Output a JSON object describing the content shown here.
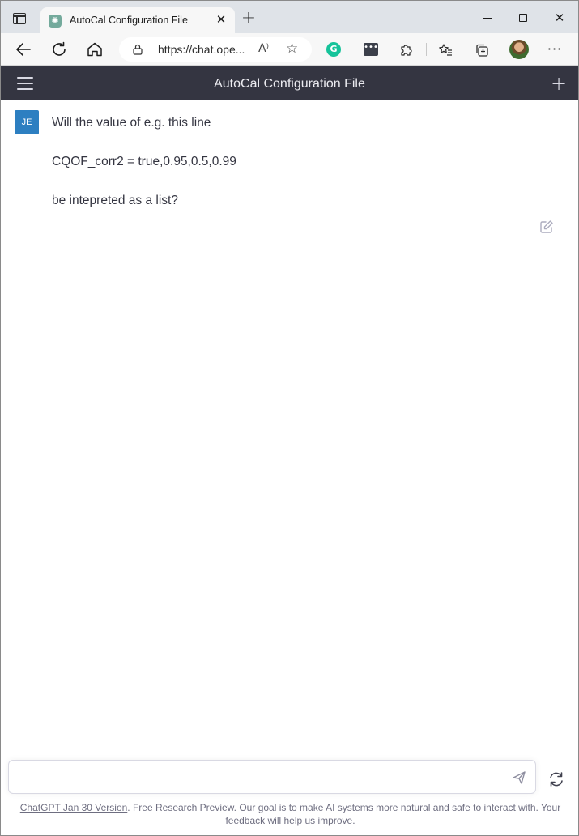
{
  "browser": {
    "tab_title": "AutoCal Configuration File",
    "tab_close": "✕",
    "new_tab": "+",
    "url": "https://chat.ope...",
    "read_aloud": "A⁾",
    "window_close": "✕"
  },
  "app": {
    "title": "AutoCal Configuration File"
  },
  "conversation": {
    "messages": [
      {
        "author_initials": "JE",
        "paragraphs": [
          "Will the value of e.g. this line",
          "CQOF_corr2 = true,0.95,0.5,0.99",
          "be intepreted as a list?"
        ]
      }
    ]
  },
  "composer": {
    "value": "",
    "placeholder": ""
  },
  "footer": {
    "link_text": "ChatGPT Jan 30 Version",
    "text": ". Free Research Preview. Our goal is to make AI systems more natural and safe to interact with. Your feedback will help us improve."
  },
  "colors": {
    "header_bg": "#343541",
    "avatar_bg": "#2d7fc1",
    "tabstrip_bg": "#dfe3e8",
    "grammarly": "#15c39a"
  },
  "icons": [
    "tab-actions-icon",
    "openai-favicon",
    "back-icon",
    "reload-icon",
    "home-icon",
    "lock-icon",
    "read-aloud-icon",
    "add-favorite-icon",
    "grammarly-icon",
    "extension-icon",
    "puzzle-icon",
    "favorites-icon",
    "collections-icon",
    "profile-avatar",
    "more-icon",
    "hamburger-icon",
    "new-chat-icon",
    "edit-icon",
    "send-icon",
    "regenerate-icon"
  ]
}
